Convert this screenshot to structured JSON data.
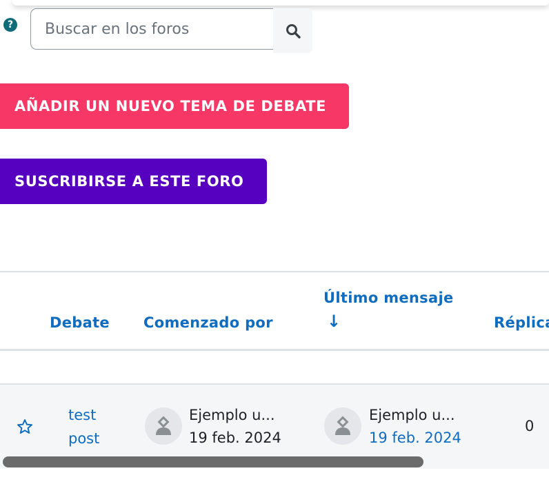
{
  "search": {
    "placeholder": "Buscar en los foros",
    "help_icon": "question-circle-icon",
    "button_icon": "search-icon"
  },
  "buttons": {
    "add_topic": "AÑADIR UN NUEVO TEMA DE DEBATE",
    "subscribe": "SUSCRIBIRSE A ESTE FORO"
  },
  "colors": {
    "add_topic_bg": "#f73866",
    "subscribe_bg": "#5600c0",
    "link": "#0f6cbf",
    "help": "#0f6c78"
  },
  "table": {
    "headers": {
      "debate": "Debate",
      "started_by": "Comenzado por",
      "last_post": "Último mensaje",
      "sort_arrow": "↓",
      "replies": "Réplica"
    },
    "rows": [
      {
        "star_icon": "star-outline-icon",
        "debate_line1": "test",
        "debate_line2": "post",
        "started_by_name": "Ejemplo u...",
        "started_by_date": "19 feb. 2024",
        "last_post_name": "Ejemplo u...",
        "last_post_date": "19 feb. 2024",
        "replies": "0"
      }
    ]
  }
}
